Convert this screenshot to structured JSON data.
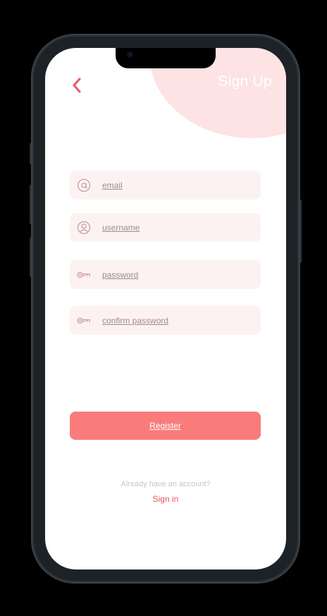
{
  "header": {
    "title": "Sign Up",
    "back_icon": "chevron-left-icon"
  },
  "form": {
    "fields": [
      {
        "name": "email",
        "placeholder": "email",
        "icon": "at-sign-icon"
      },
      {
        "name": "username",
        "placeholder": "username",
        "icon": "user-icon"
      },
      {
        "name": "password",
        "placeholder": "password",
        "icon": "key-icon"
      },
      {
        "name": "confirm_password",
        "placeholder": "confirm password",
        "icon": "key-icon"
      }
    ],
    "submit_label": "Register"
  },
  "footer": {
    "prompt": "Already have an account?",
    "link_label": "Sign in"
  },
  "colors": {
    "accent": "#fa7b7b",
    "link": "#e9575c",
    "field_bg": "#fdf2f2",
    "header_blob": "#fde3e3"
  }
}
